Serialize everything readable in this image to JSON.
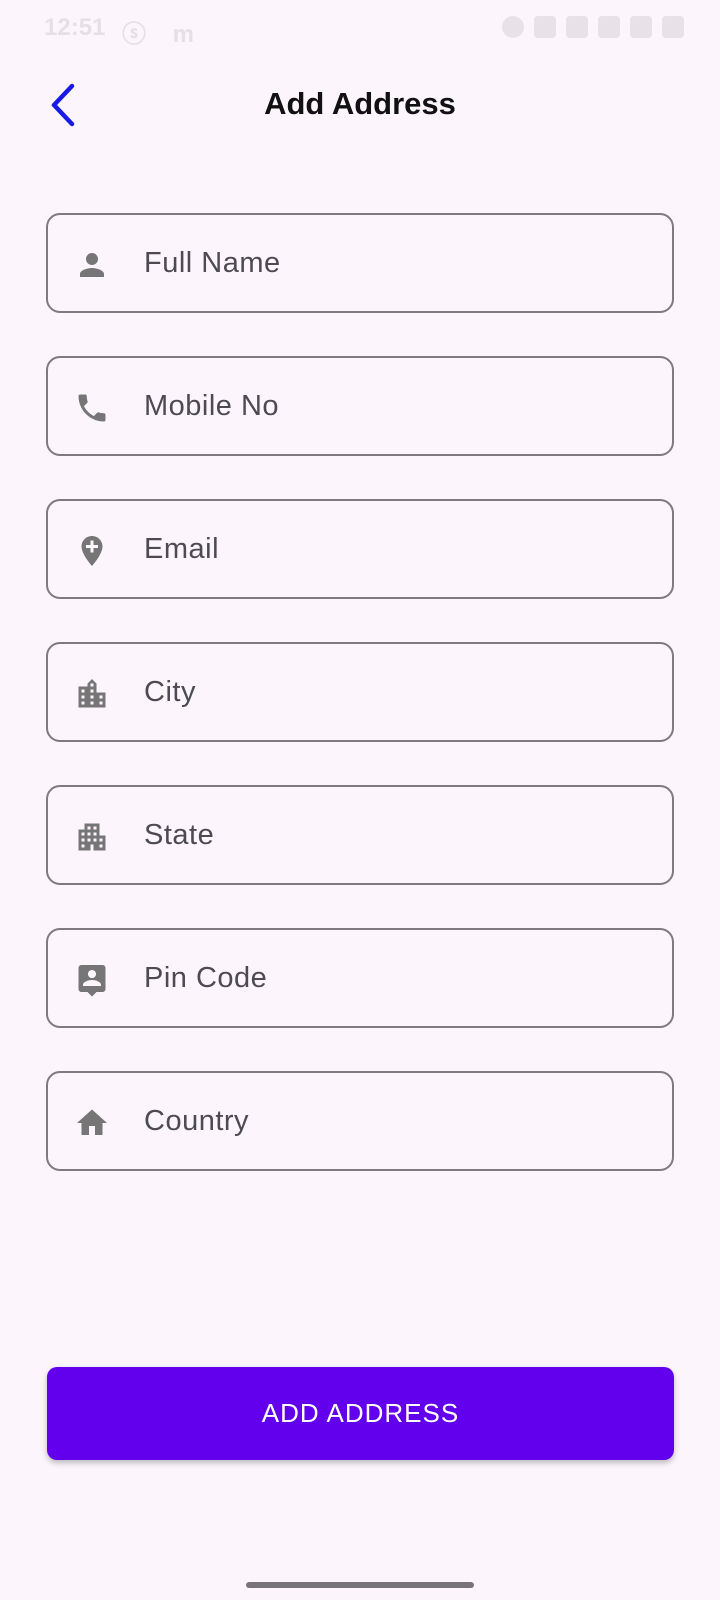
{
  "status_bar": {
    "time": "12:51",
    "left_icons": "ⓢ m"
  },
  "header": {
    "title": "Add Address",
    "back_icon": "chevron-left-icon"
  },
  "form": {
    "fields": [
      {
        "placeholder": "Full Name",
        "icon": "person-icon"
      },
      {
        "placeholder": "Mobile No",
        "icon": "phone-icon"
      },
      {
        "placeholder": "Email",
        "icon": "add-location-icon"
      },
      {
        "placeholder": "City",
        "icon": "city-icon"
      },
      {
        "placeholder": "State",
        "icon": "apartment-icon"
      },
      {
        "placeholder": "Pin Code",
        "icon": "contact-pin-icon"
      },
      {
        "placeholder": "Country",
        "icon": "home-icon"
      }
    ]
  },
  "submit": {
    "label": "ADD ADDRESS"
  },
  "colors": {
    "background": "#FCF6FC",
    "accent": "#6200EE",
    "back_icon": "#1A1AE6",
    "field_border": "#7E7A80",
    "icon": "#767676"
  }
}
